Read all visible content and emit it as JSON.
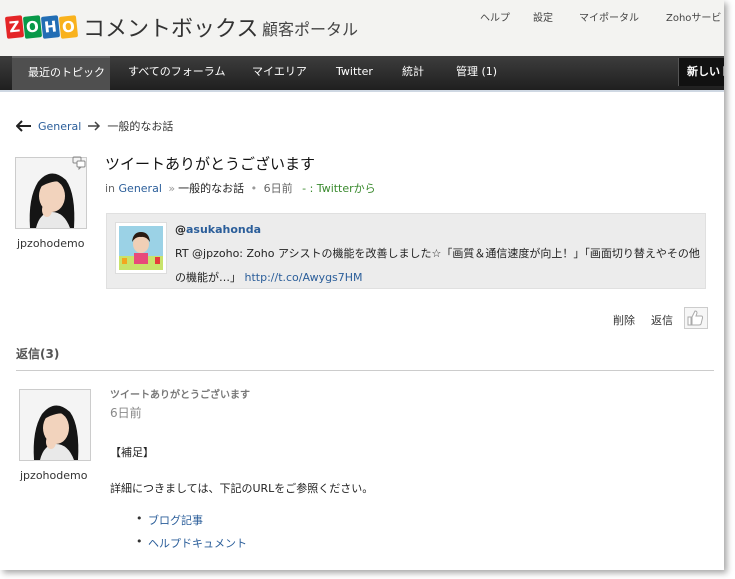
{
  "header": {
    "logo_brand": "ZOHO",
    "product": "コメントボックス",
    "portal_title": "顧客ポータル",
    "links": [
      "ヘルプ",
      "設定",
      "マイポータル",
      "Zohoサービ"
    ]
  },
  "nav": {
    "items": [
      "最近のトピック",
      "すべてのフォーラム",
      "マイエリア",
      "Twitter",
      "統計",
      "管理 (1)"
    ],
    "active_index": 0,
    "new_button": "新しいト"
  },
  "breadcrumb": {
    "forum": "General",
    "sub": "一般的なお話"
  },
  "topic": {
    "title": "ツイートありがとうございます",
    "meta_in": "in",
    "category": "General",
    "sep": "»",
    "subcategory": "一般的なお話",
    "time": "6日前",
    "source": "- : Twitterから",
    "author": "jpzohodemo"
  },
  "tweet": {
    "at": "@",
    "user": "asukahonda",
    "text": "RT @jpzoho: Zoho アシストの機能を改善しました☆「画質＆通信速度が向上！」「画面切り替えやその他の機能が…」",
    "link": "http://t.co/Awygs7HM"
  },
  "actions": {
    "delete": "削除",
    "reply": "返信"
  },
  "replies": {
    "heading": "返信(3)",
    "items": [
      {
        "title": "ツイートありがとうございます",
        "time": "6日前",
        "author": "jpzohodemo",
        "lines": [
          "【補足】",
          "詳細につきましては、下記のURLをご参照ください。"
        ],
        "links": [
          "ブログ記事",
          "ヘルプドキュメント"
        ]
      }
    ]
  },
  "colors": {
    "nav_bg": "#2a2a2a",
    "link": "#2b5e9a",
    "green": "#3a8a2e"
  }
}
